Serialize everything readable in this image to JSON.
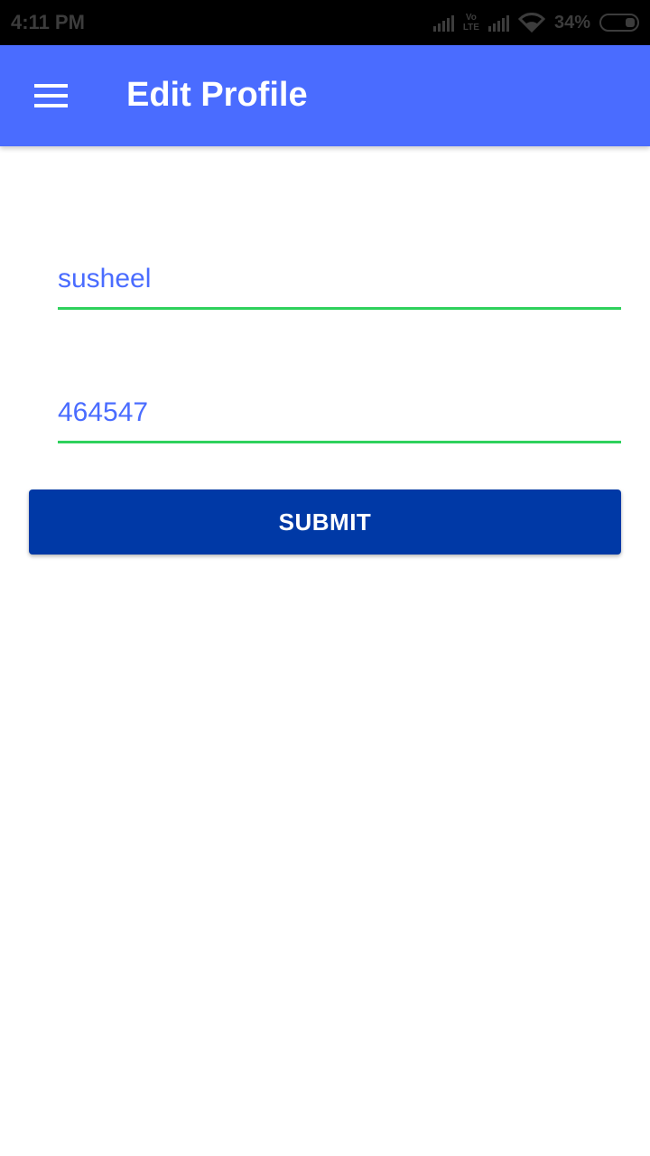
{
  "status_bar": {
    "time": "4:11 PM",
    "volte_top": "Vo",
    "volte_bottom": "LTE",
    "battery_percent": "34%",
    "icons": [
      "signal-icon",
      "volte-icon",
      "signal-icon",
      "wifi-icon",
      "battery-icon"
    ]
  },
  "app_bar": {
    "title": "Edit Profile",
    "menu_icon": "hamburger-menu-icon",
    "color": "#4a6cff"
  },
  "form": {
    "name_value": "susheel",
    "code_value": "464547",
    "underline_color": "#2ed15c",
    "text_color": "#4a6cff"
  },
  "submit": {
    "label": "SUBMIT",
    "color": "#0039a6"
  }
}
